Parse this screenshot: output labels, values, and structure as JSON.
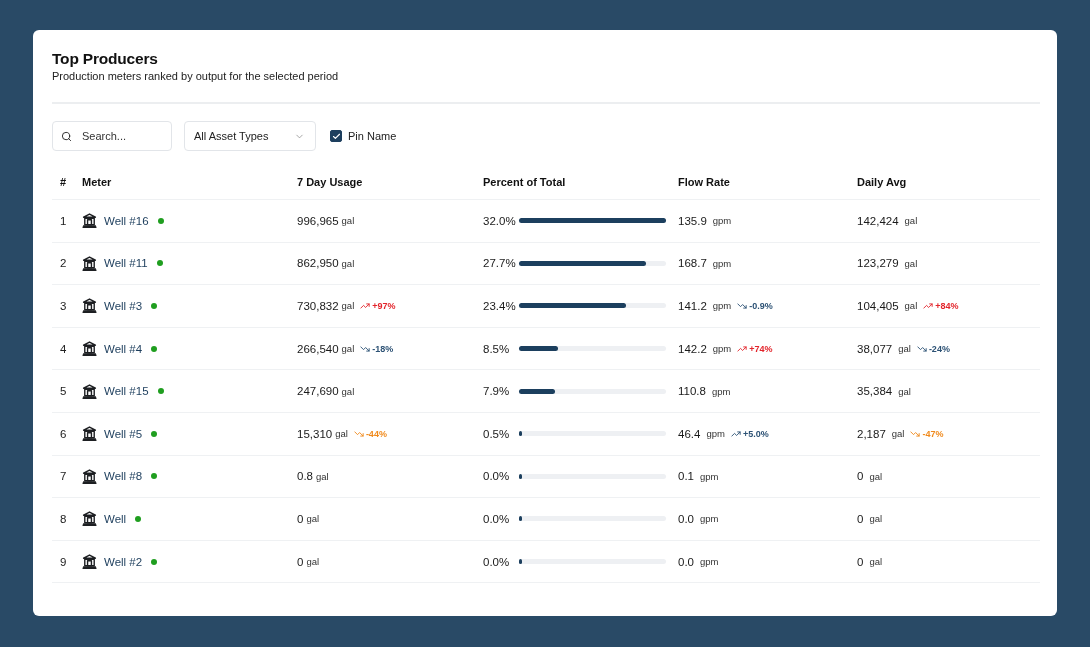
{
  "header": {
    "title": "Top Producers",
    "subtitle": "Production meters ranked by output for the selected period"
  },
  "filters": {
    "search": {
      "placeholder": "Search..."
    },
    "asset_type": {
      "value": "All Asset Types"
    },
    "pin_name": {
      "label": "Pin Name",
      "checked": true
    }
  },
  "table": {
    "columns": [
      "#",
      "Meter",
      "7 Day Usage",
      "Percent of Total",
      "Flow Rate",
      "Daily Avg"
    ],
    "rows": [
      {
        "rank": "1",
        "meter": "Well #16",
        "status": {
          "color": "#1f9e1f"
        },
        "usage": {
          "value": "996,965",
          "unit": "gal"
        },
        "percent": {
          "text": "32.0%",
          "level": 1
        },
        "flow": {
          "value": "135.9",
          "unit": "gpm"
        },
        "daily": {
          "value": "142,424",
          "unit": "gal"
        }
      },
      {
        "rank": "2",
        "meter": "Well #11",
        "status": {
          "color": "#1f9e1f"
        },
        "usage": {
          "value": "862,950",
          "unit": "gal"
        },
        "percent": {
          "text": "27.7%",
          "level": 0.866
        },
        "flow": {
          "value": "168.7",
          "unit": "gpm"
        },
        "daily": {
          "value": "123,279",
          "unit": "gal"
        }
      },
      {
        "rank": "3",
        "meter": "Well #3",
        "status": {
          "color": "#1f9e1f"
        },
        "usage": {
          "value": "730,832",
          "unit": "gal",
          "trend": {
            "kind": "up",
            "text": "+97%",
            "color": "#e3242b"
          }
        },
        "percent": {
          "text": "23.4%",
          "level": 0.731
        },
        "flow": {
          "value": "141.2",
          "unit": "gpm",
          "trend": {
            "kind": "down",
            "text": "-0.9%",
            "color": "#2d5275"
          }
        },
        "daily": {
          "value": "104,405",
          "unit": "gal",
          "trend": {
            "kind": "up",
            "text": "+84%",
            "color": "#e3242b"
          }
        }
      },
      {
        "rank": "4",
        "meter": "Well #4",
        "status": {
          "color": "#1f9e1f"
        },
        "usage": {
          "value": "266,540",
          "unit": "gal",
          "trend": {
            "kind": "down",
            "text": "-18%",
            "color": "#2d5275"
          }
        },
        "percent": {
          "text": "8.5%",
          "level": 0.266
        },
        "flow": {
          "value": "142.2",
          "unit": "gpm",
          "trend": {
            "kind": "up",
            "text": "+74%",
            "color": "#e3242b"
          }
        },
        "daily": {
          "value": "38,077",
          "unit": "gal",
          "trend": {
            "kind": "down",
            "text": "-24%",
            "color": "#2d5275"
          }
        }
      },
      {
        "rank": "5",
        "meter": "Well #15",
        "status": {
          "color": "#1f9e1f"
        },
        "usage": {
          "value": "247,690",
          "unit": "gal"
        },
        "percent": {
          "text": "7.9%",
          "level": 0.247
        },
        "flow": {
          "value": "110.8",
          "unit": "gpm"
        },
        "daily": {
          "value": "35,384",
          "unit": "gal"
        }
      },
      {
        "rank": "6",
        "meter": "Well #5",
        "status": {
          "color": "#1f9e1f"
        },
        "usage": {
          "value": "15,310",
          "unit": "gal",
          "trend": {
            "kind": "down",
            "text": "-44%",
            "color": "#f08a1c"
          }
        },
        "percent": {
          "text": "0.5%",
          "level": 0.016
        },
        "flow": {
          "value": "46.4",
          "unit": "gpm",
          "trend": {
            "kind": "up",
            "text": "+5.0%",
            "color": "#2d5275"
          }
        },
        "daily": {
          "value": "2,187",
          "unit": "gal",
          "trend": {
            "kind": "down",
            "text": "-47%",
            "color": "#f08a1c"
          }
        }
      },
      {
        "rank": "7",
        "meter": "Well #8",
        "status": {
          "color": "#1f9e1f"
        },
        "usage": {
          "value": "0.8",
          "unit": "gal"
        },
        "percent": {
          "text": "0.0%",
          "level": 0
        },
        "flow": {
          "value": "0.1",
          "unit": "gpm"
        },
        "daily": {
          "value": "0",
          "unit": "gal"
        }
      },
      {
        "rank": "8",
        "meter": "Well",
        "status": {
          "color": "#1f9e1f"
        },
        "usage": {
          "value": "0",
          "unit": "gal"
        },
        "percent": {
          "text": "0.0%",
          "level": 0
        },
        "flow": {
          "value": "0.0",
          "unit": "gpm"
        },
        "daily": {
          "value": "0",
          "unit": "gal"
        }
      },
      {
        "rank": "9",
        "meter": "Well #2",
        "status": {
          "color": "#1f9e1f"
        },
        "usage": {
          "value": "0",
          "unit": "gal"
        },
        "percent": {
          "text": "0.0%",
          "level": 0
        },
        "flow": {
          "value": "0.0",
          "unit": "gpm"
        },
        "daily": {
          "value": "0",
          "unit": "gal"
        }
      }
    ]
  }
}
